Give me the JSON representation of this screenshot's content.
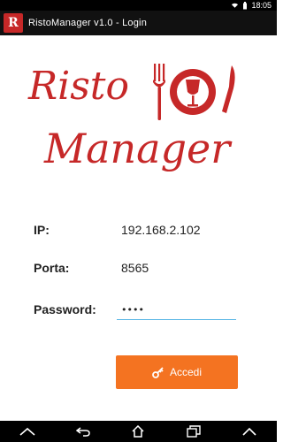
{
  "status_bar": {
    "time": "18:05"
  },
  "app_bar": {
    "title": "RistoManager v1.0 - Login",
    "logo_letters": "R"
  },
  "brand": {
    "line1": "Risto",
    "line2": "Manager",
    "color": "#c62828"
  },
  "form": {
    "ip_label": "IP:",
    "ip_value": "192.168.2.102",
    "port_label": "Porta:",
    "port_value": "8565",
    "password_label": "Password:",
    "password_value": "••••"
  },
  "login_button": {
    "label": "Accedi",
    "color": "#f47321"
  },
  "nav_bar": {
    "icons": [
      "home-up-icon",
      "back-icon",
      "home-icon",
      "recent-apps-icon",
      "menu-icon"
    ]
  }
}
